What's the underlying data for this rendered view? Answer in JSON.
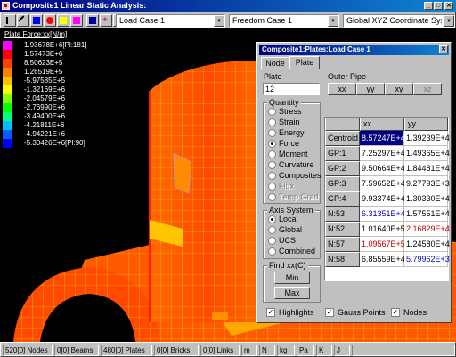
{
  "window": {
    "title": "Composite1 Linear Static Analysis:"
  },
  "toolbar": {
    "load_case": "Load Case 1",
    "freedom_case": "Freedom Case 1",
    "coordinate_system": "Global XYZ Coordinate System"
  },
  "legend": {
    "title": "Plate Force:xx[N/m]",
    "items": [
      {
        "value": "1.93678E+6[Pl:181]",
        "color": "#ff00ff"
      },
      {
        "value": "1.57473E+6",
        "color": "#ff0000"
      },
      {
        "value": "8.50623E+5",
        "color": "#ff4000"
      },
      {
        "value": "1.26519E+5",
        "color": "#ff8000"
      },
      {
        "value": "-5.97585E+5",
        "color": "#ffc000"
      },
      {
        "value": "-1.32169E+6",
        "color": "#ffff00"
      },
      {
        "value": "-2.04579E+6",
        "color": "#80ff00"
      },
      {
        "value": "-2.76990E+6",
        "color": "#00ff00"
      },
      {
        "value": "-3.49400E+6",
        "color": "#00ff80"
      },
      {
        "value": "-4.21811E+6",
        "color": "#00c0ff"
      },
      {
        "value": "-4.94221E+6",
        "color": "#0060ff"
      },
      {
        "value": "-5.30426E+6[Pl:90]",
        "color": "#0000ff"
      }
    ]
  },
  "dialog": {
    "title": "Composite1:Plates:Load Case 1",
    "tabs": [
      "Node",
      "Plate"
    ],
    "plate_label": "Plate",
    "plate_value": "12",
    "outer_pipe_label": "Outer Pipe",
    "layer_buttons": [
      "xx",
      "yy",
      "xy",
      "xz"
    ],
    "quantity": {
      "title": "Quantity",
      "options": [
        "Stress",
        "Strain",
        "Energy",
        "Force",
        "Moment",
        "Curvature",
        "Composites",
        "Flux",
        "Temp Grad"
      ],
      "selected": "Force"
    },
    "axis_system": {
      "title": "Axis System",
      "options": [
        "Local",
        "Global",
        "UCS",
        "Combined"
      ],
      "selected": "Local"
    },
    "find": {
      "title": "Find xx(C)",
      "min": "Min",
      "max": "Max"
    },
    "table": {
      "columns": [
        "xx",
        "yy"
      ],
      "rows": [
        {
          "label": "Centroid",
          "xx": "8.57247E+4",
          "yy": "1.39239E+4"
        },
        {
          "label": "GP:1",
          "xx": "7.25297E+4",
          "yy": "1.49365E+4"
        },
        {
          "label": "GP:2",
          "xx": "9.50664E+4",
          "yy": "1.84481E+4"
        },
        {
          "label": "GP:3",
          "xx": "7.59652E+4",
          "yy": "9.27793E+3"
        },
        {
          "label": "GP:4",
          "xx": "9.93374E+4",
          "yy": "1.30330E+4"
        },
        {
          "label": "N:53",
          "xx": "6.31351E+4",
          "yy": "1.57551E+4"
        },
        {
          "label": "N:52",
          "xx": "1.01640E+5",
          "yy": "2.16829E+4"
        },
        {
          "label": "N:57",
          "xx": "1.09567E+5",
          "yy": "1.24580E+4"
        },
        {
          "label": "N:58",
          "xx": "6.85559E+4",
          "yy": "5.79962E+3"
        }
      ]
    },
    "checks": [
      "Highlights",
      "Gauss Points",
      "Nodes"
    ]
  },
  "status": [
    "520[0] Nodes",
    "0[0] Beams",
    "480[0] Plates",
    "0[0] Bricks",
    "0[0] Links",
    "m",
    "N",
    "kg",
    "Pa",
    "K",
    "J"
  ]
}
